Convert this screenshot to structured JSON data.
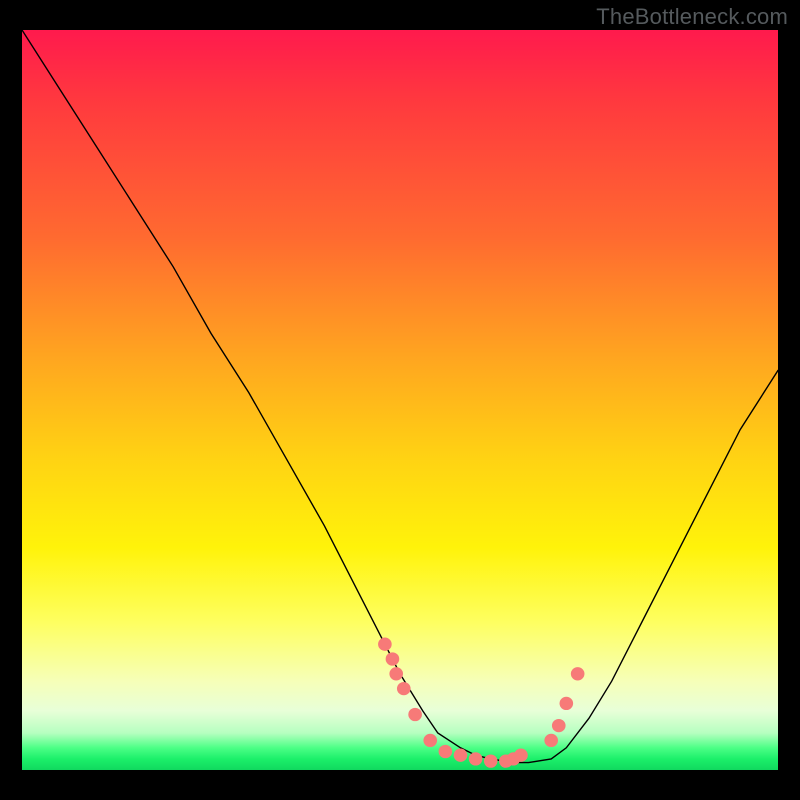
{
  "watermark": "TheBottleneck.com",
  "chart_data": {
    "type": "line",
    "title": "",
    "xlabel": "",
    "ylabel": "",
    "xlim": [
      0,
      100
    ],
    "ylim": [
      0,
      100
    ],
    "series": [
      {
        "name": "bottleneck-curve",
        "x": [
          0,
          5,
          10,
          15,
          20,
          25,
          30,
          35,
          40,
          45,
          48,
          50,
          53,
          55,
          58,
          60,
          62,
          65,
          67,
          70,
          72,
          75,
          78,
          82,
          86,
          90,
          95,
          100
        ],
        "y": [
          100,
          92,
          84,
          76,
          68,
          59,
          51,
          42,
          33,
          23,
          17,
          13,
          8,
          5,
          3,
          2,
          1.5,
          1,
          1,
          1.5,
          3,
          7,
          12,
          20,
          28,
          36,
          46,
          54
        ]
      }
    ],
    "scatter_points": {
      "name": "marker-dots",
      "color": "#f77a78",
      "x": [
        48,
        49,
        49.5,
        50.5,
        52,
        54,
        56,
        58,
        60,
        62,
        64,
        65,
        66,
        70,
        71,
        72,
        73.5
      ],
      "y": [
        17,
        15,
        13,
        11,
        7.5,
        4,
        2.5,
        2,
        1.5,
        1.2,
        1.2,
        1.5,
        2,
        4,
        6,
        9,
        13
      ]
    },
    "background_gradient_stops": [
      {
        "pos": 0.0,
        "color": "#ff1a4d"
      },
      {
        "pos": 0.28,
        "color": "#ff6a30"
      },
      {
        "pos": 0.58,
        "color": "#ffd313"
      },
      {
        "pos": 0.88,
        "color": "#f6ffb8"
      },
      {
        "pos": 0.97,
        "color": "#4cff86"
      },
      {
        "pos": 1.0,
        "color": "#11d85f"
      }
    ]
  }
}
